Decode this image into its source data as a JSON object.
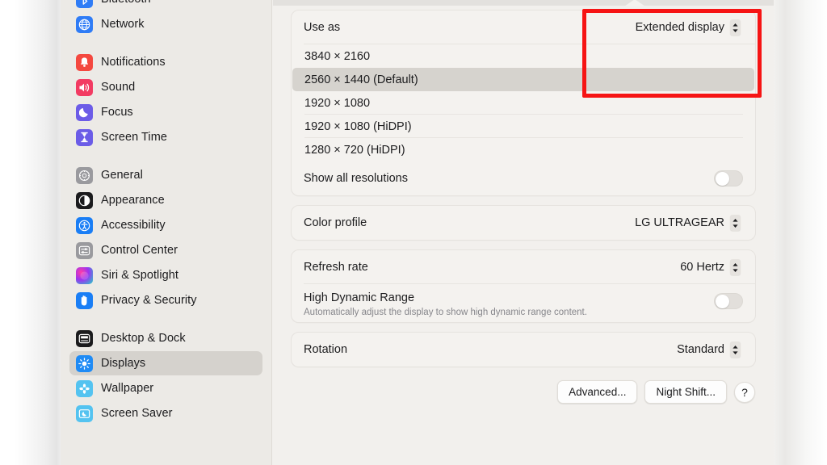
{
  "sidebar": {
    "groups": [
      {
        "items": [
          {
            "label": "Bluetooth",
            "icon": "bluetooth-icon",
            "selected": false,
            "clipped": true
          },
          {
            "label": "Network",
            "icon": "globe-icon",
            "selected": false
          }
        ]
      },
      {
        "items": [
          {
            "label": "Notifications",
            "icon": "bell-icon",
            "selected": false
          },
          {
            "label": "Sound",
            "icon": "speaker-icon",
            "selected": false
          },
          {
            "label": "Focus",
            "icon": "moon-icon",
            "selected": false
          },
          {
            "label": "Screen Time",
            "icon": "hourglass-icon",
            "selected": false
          }
        ]
      },
      {
        "items": [
          {
            "label": "General",
            "icon": "gear-icon",
            "selected": false
          },
          {
            "label": "Appearance",
            "icon": "contrast-circle-icon",
            "selected": false
          },
          {
            "label": "Accessibility",
            "icon": "accessibility-person-icon",
            "selected": false
          },
          {
            "label": "Control Center",
            "icon": "sliders-icon",
            "selected": false
          },
          {
            "label": "Siri & Spotlight",
            "icon": "siri-orb-icon",
            "selected": false
          },
          {
            "label": "Privacy & Security",
            "icon": "hand-icon",
            "selected": false
          }
        ]
      },
      {
        "items": [
          {
            "label": "Desktop & Dock",
            "icon": "desktop-dock-icon",
            "selected": false
          },
          {
            "label": "Displays",
            "icon": "brightness-sun-icon",
            "selected": true
          },
          {
            "label": "Wallpaper",
            "icon": "flower-icon",
            "selected": false
          },
          {
            "label": "Screen Saver",
            "icon": "screensaver-icon",
            "selected": false
          }
        ]
      }
    ]
  },
  "main": {
    "use_as": {
      "label": "Use as",
      "value": "Extended display"
    },
    "resolutions": [
      {
        "label": "3840 × 2160",
        "selected": false
      },
      {
        "label": "2560 × 1440 (Default)",
        "selected": true
      },
      {
        "label": "1920 × 1080",
        "selected": false
      },
      {
        "label": "1920 × 1080 (HiDPI)",
        "selected": false
      },
      {
        "label": "1280 × 720 (HiDPI)",
        "selected": false
      }
    ],
    "show_all_resolutions": {
      "label": "Show all resolutions",
      "state": "off"
    },
    "color_profile": {
      "label": "Color profile",
      "value": "LG ULTRAGEAR"
    },
    "refresh_rate": {
      "label": "Refresh rate",
      "value": "60 Hertz"
    },
    "hdr": {
      "label": "High Dynamic Range",
      "description": "Automatically adjust the display to show high dynamic range content.",
      "state": "off"
    },
    "rotation": {
      "label": "Rotation",
      "value": "Standard"
    },
    "buttons": {
      "advanced": "Advanced...",
      "night_shift": "Night Shift...",
      "help": "?"
    }
  },
  "annotation": {
    "color": "#f61414",
    "target": "use-as-popup"
  }
}
